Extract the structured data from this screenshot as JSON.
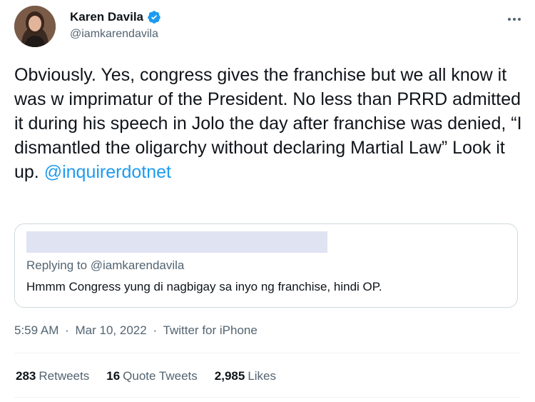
{
  "author": {
    "display_name": "Karen Davila",
    "handle": "@iamkarendavila",
    "verified": true,
    "verified_color": "#1d9bf0"
  },
  "tweet": {
    "text": "Obviously. Yes, congress gives the franchise but we all know it was w imprimatur of the President. No less than PRRD admitted it during his speech in Jolo the day after franchise was denied, “I dismantled the oligarchy without declaring Martial Law” Look it up. ",
    "mention": "@inquirerdotnet",
    "link_color": "#1d9bf0"
  },
  "quoted": {
    "replying_to": "Replying to @iamkarendavila",
    "text": "Hmmm Congress yung di nagbigay sa inyo ng franchise, hindi OP."
  },
  "meta": {
    "time": "5:59 AM",
    "separator": "·",
    "date": "Mar 10, 2022",
    "source": "Twitter for iPhone"
  },
  "stats": {
    "retweets_count": "283",
    "retweets_label": "Retweets",
    "quotes_count": "16",
    "quotes_label": "Quote Tweets",
    "likes_count": "2,985",
    "likes_label": "Likes"
  },
  "icons": {
    "more": "more-horizontal-icon",
    "verified": "verified-badge-icon"
  }
}
